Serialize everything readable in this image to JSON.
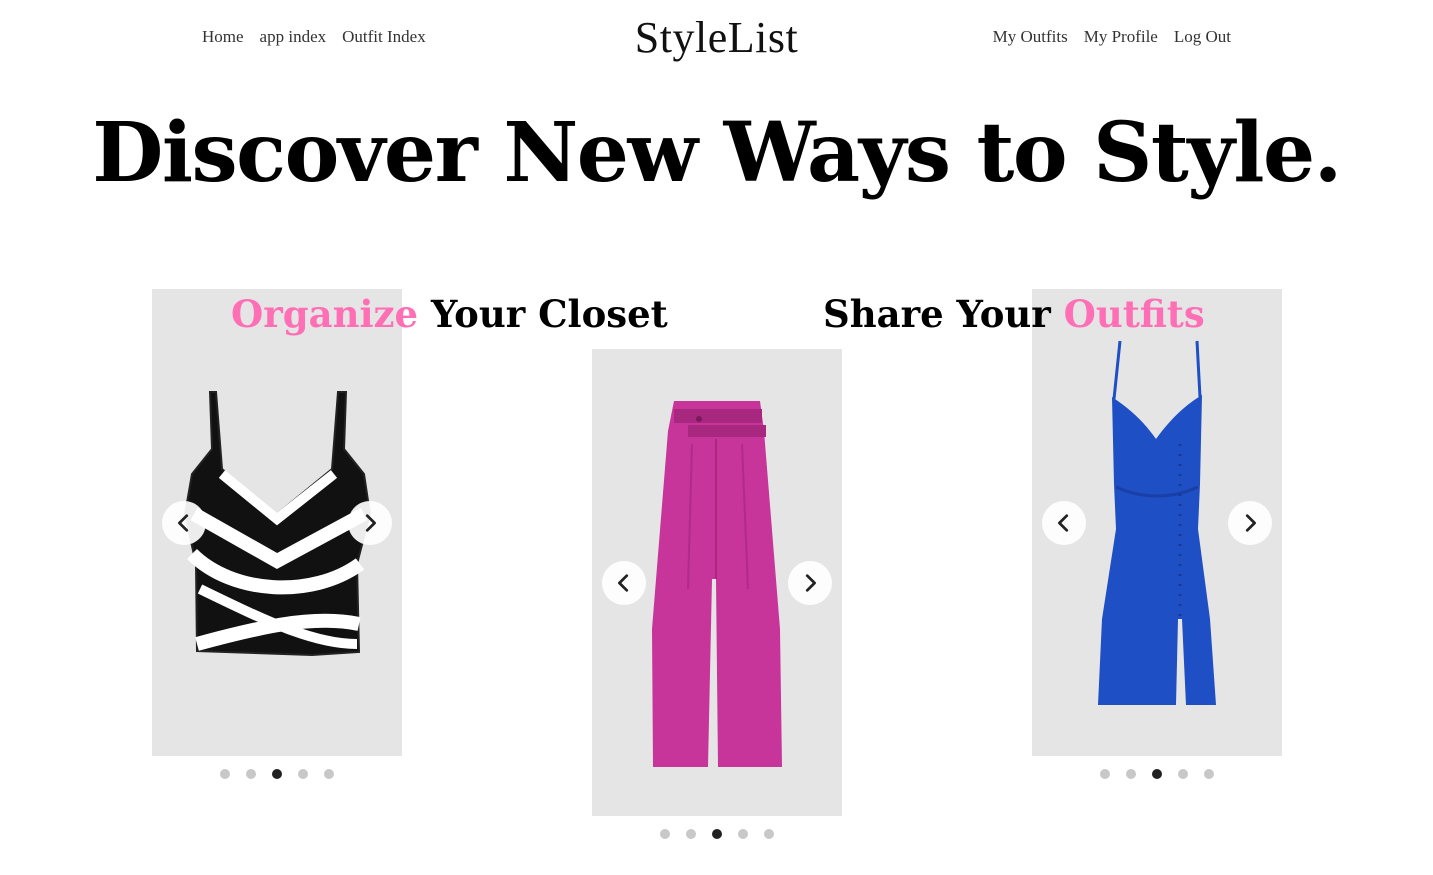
{
  "nav": {
    "left": [
      "Home",
      "app index",
      "Outfit Index"
    ],
    "right": [
      "My Outfits",
      "My Profile",
      "Log Out"
    ],
    "brand": "StyleList"
  },
  "hero": {
    "title": "Discover New Ways to Style."
  },
  "taglines": {
    "organize": {
      "accent": "Organize",
      "rest": " Your Closet"
    },
    "share": {
      "rest": "Share Your ",
      "accent": "Outfits"
    }
  },
  "carousels": [
    {
      "item": "crop-top-icon",
      "active_dot": 3,
      "dot_count": 5
    },
    {
      "item": "pants-icon",
      "active_dot": 3,
      "dot_count": 5
    },
    {
      "item": "dress-icon",
      "active_dot": 3,
      "dot_count": 5
    }
  ],
  "colors": {
    "accent": "#ff6fb5",
    "card_bg": "#e5e5e6",
    "pants": "#c7349a",
    "dress": "#1f4fc4"
  },
  "icons": {
    "prev": "chevron-left-icon",
    "next": "chevron-right-icon"
  }
}
